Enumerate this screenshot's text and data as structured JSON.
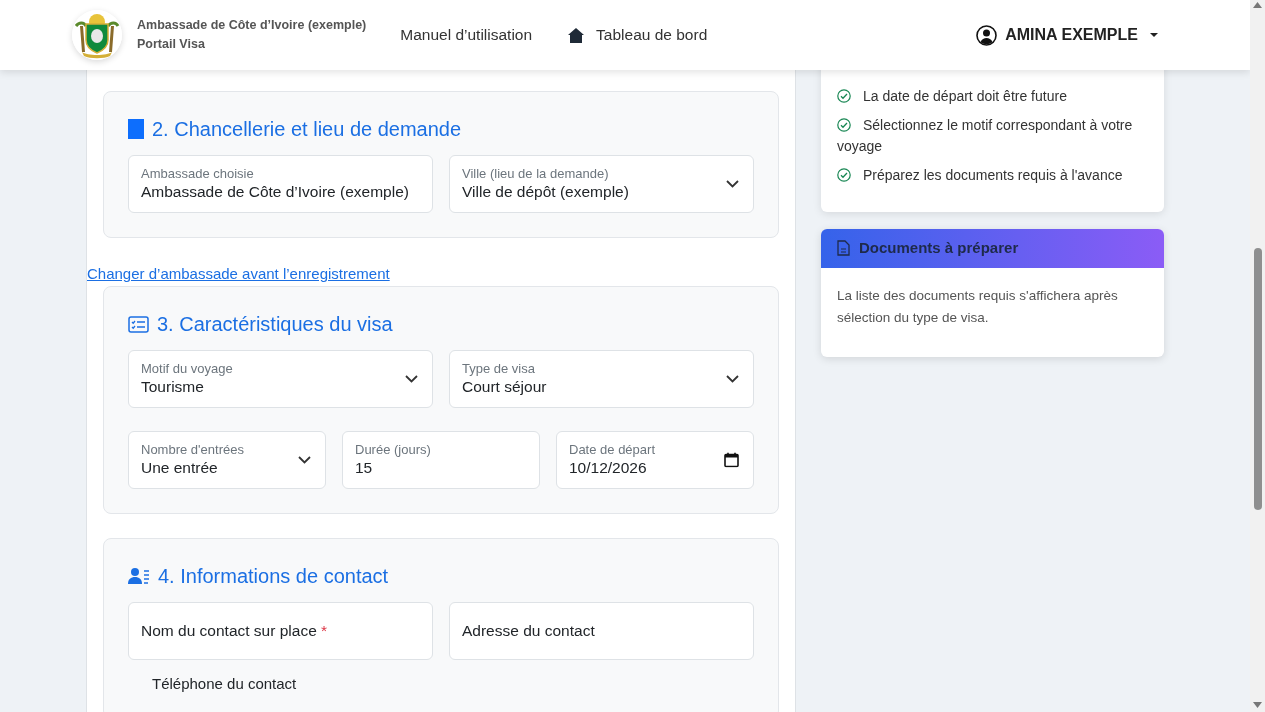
{
  "navbar": {
    "brand_title": "Ambassade de Côte d’Ivoire (exemple)",
    "brand_subtitle": "Portail Visa",
    "links": [
      {
        "label": "Manuel d’utilisation"
      },
      {
        "label": "Tableau de bord"
      }
    ],
    "user": "AMINA EXEMPLE"
  },
  "form": {
    "blocks": [
      {
        "kind": "section",
        "title": "2. Chancellerie et lieu de demande",
        "rows": [
          [
            {
              "kind": "text",
              "label": "Ambassade choisie",
              "value": "Ambassade de Côte d’Ivoire (exemple)"
            },
            {
              "kind": "select",
              "label": "Ville (lieu de la demande)",
              "value": "Ville de dépôt (exemple)"
            }
          ]
        ]
      },
      {
        "kind": "link",
        "label": "Changer d’ambassade avant l’enregistrement"
      },
      {
        "kind": "section",
        "title": "3. Caractéristiques du visa",
        "rows": [
          [
            {
              "kind": "select",
              "label": "Motif du voyage",
              "value": "Tourisme"
            },
            {
              "kind": "select",
              "label": "Type de visa",
              "value": "Court séjour"
            }
          ],
          [
            {
              "kind": "select",
              "label": "Nombre d'entrées",
              "value": "Une entrée"
            },
            {
              "kind": "text",
              "label": "Durée (jours)",
              "value": "15"
            },
            {
              "kind": "date",
              "label": "Date de départ",
              "value": "10/12/2026"
            }
          ]
        ]
      },
      {
        "kind": "section",
        "title": "4. Informations de contact",
        "rows": [
          [
            {
              "kind": "empty",
              "label": "Nom du contact sur place",
              "required_mark": "*"
            },
            {
              "kind": "empty",
              "label": "Adresse du contact"
            }
          ]
        ],
        "next_label": "Téléphone du contact"
      }
    ]
  },
  "sidebar": {
    "tips": [
      "La date de départ doit être future",
      "Sélectionnez le motif correspondant à votre voyage",
      "Préparez les documents requis à l'avance"
    ],
    "documents": {
      "title": "Documents à préparer",
      "text": "La liste des documents requis s'affichera après sélection du type de visa."
    }
  }
}
